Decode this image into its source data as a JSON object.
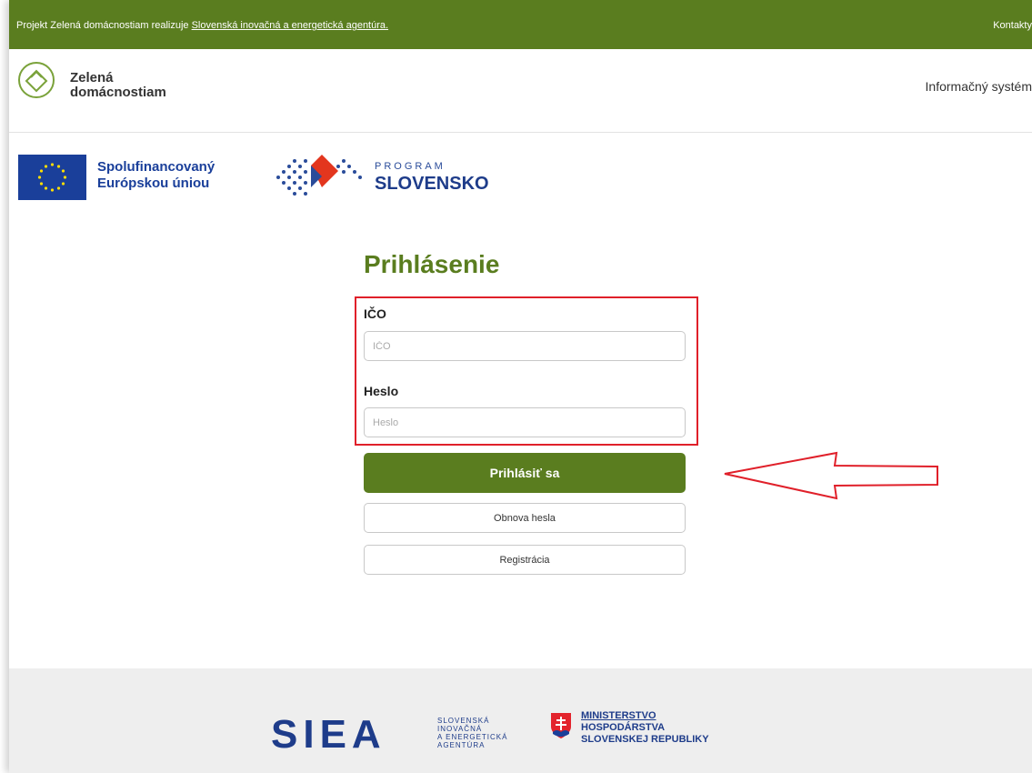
{
  "topbar": {
    "prefix": "Projekt Zelená domácnostiam realizuje ",
    "link": "Slovenská inovačná a energetická agentúra.",
    "contacts": "Kontakty"
  },
  "header": {
    "logo_line1": "Zelená",
    "logo_line2": "domácnostiam",
    "system_label": "Informačný systém"
  },
  "partners": {
    "eu_line1": "Spolufinancovaný",
    "eu_line2": "Európskou úniou",
    "program_small": "PROGRAM",
    "program_big": "SLOVENSKO"
  },
  "login": {
    "title": "Prihlásenie",
    "ico_label": "IČO",
    "ico_placeholder": "IČO",
    "password_label": "Heslo",
    "password_placeholder": "Heslo",
    "submit_label": "Prihlásiť sa",
    "reset_label": "Obnova hesla",
    "register_label": "Registrácia"
  },
  "footer": {
    "siea_logo": "SIEA",
    "siea_line1": "SLOVENSKÁ",
    "siea_line2": "INOVAČNÁ",
    "siea_line3": "A ENERGETICKÁ",
    "siea_line4": "AGENTÚRA",
    "ministry_line1": "MINISTERSTVO",
    "ministry_line2": "HOSPODÁRSTVA",
    "ministry_line3": "SLOVENSKEJ REPUBLIKY"
  },
  "colors": {
    "brand_green": "#5a7d1f",
    "highlight_red": "#e0202a",
    "eu_blue": "#1a3f9a"
  }
}
